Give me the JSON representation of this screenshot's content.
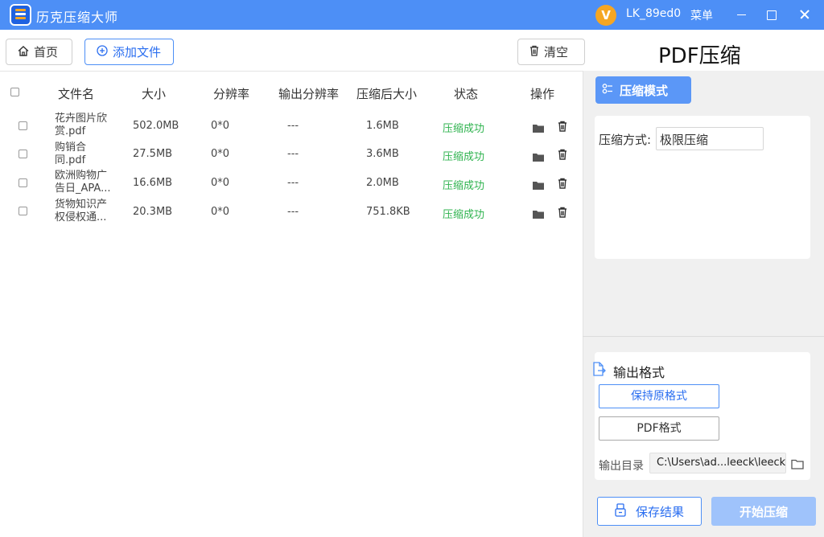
{
  "window": {
    "app_title": "历克压缩大师",
    "avatar_letter": "V",
    "username": "LK_89ed0",
    "menu_label": "菜单"
  },
  "toolbar": {
    "home_label": "首页",
    "add_label": "添加文件",
    "clear_label": "清空"
  },
  "page_heading": "PDF压缩",
  "table": {
    "headers": {
      "name": "文件名",
      "size": "大小",
      "resolution": "分辨率",
      "out_resolution": "输出分辨率",
      "compressed_size": "压缩后大小",
      "status": "状态",
      "actions": "操作"
    },
    "rows": [
      {
        "name_line1": "花卉图片欣",
        "name_line2": "赏.pdf",
        "size": "502.0MB",
        "resolution": "0*0",
        "out_resolution": "---",
        "compressed_size": "1.6MB",
        "status": "压缩成功"
      },
      {
        "name_line1": "购销合",
        "name_line2": "同.pdf",
        "size": "27.5MB",
        "resolution": "0*0",
        "out_resolution": "---",
        "compressed_size": "3.6MB",
        "status": "压缩成功"
      },
      {
        "name_line1": "欧洲购物广",
        "name_line2": "告日_APA...",
        "size": "16.6MB",
        "resolution": "0*0",
        "out_resolution": "---",
        "compressed_size": "2.0MB",
        "status": "压缩成功"
      },
      {
        "name_line1": "货物知识产",
        "name_line2": "权侵权通...",
        "size": "20.3MB",
        "resolution": "0*0",
        "out_resolution": "---",
        "compressed_size": "751.8KB",
        "status": "压缩成功"
      }
    ]
  },
  "compress_mode": {
    "tab_label": "压缩模式",
    "method_label": "压缩方式:",
    "method_value": "极限压缩"
  },
  "output": {
    "title": "输出格式",
    "keep_format_label": "保持原格式",
    "pdf_format_label": "PDF格式",
    "dir_label": "输出目录",
    "dir_value": "C:\\Users\\ad...leeck\\leeck"
  },
  "actions": {
    "save_label": "保存结果",
    "start_label": "开始压缩"
  },
  "colors": {
    "titlebar": "#4d8ff6",
    "accent": "#2a6ef0",
    "success": "#2fb34f",
    "start_button": "#9fc3fb"
  }
}
